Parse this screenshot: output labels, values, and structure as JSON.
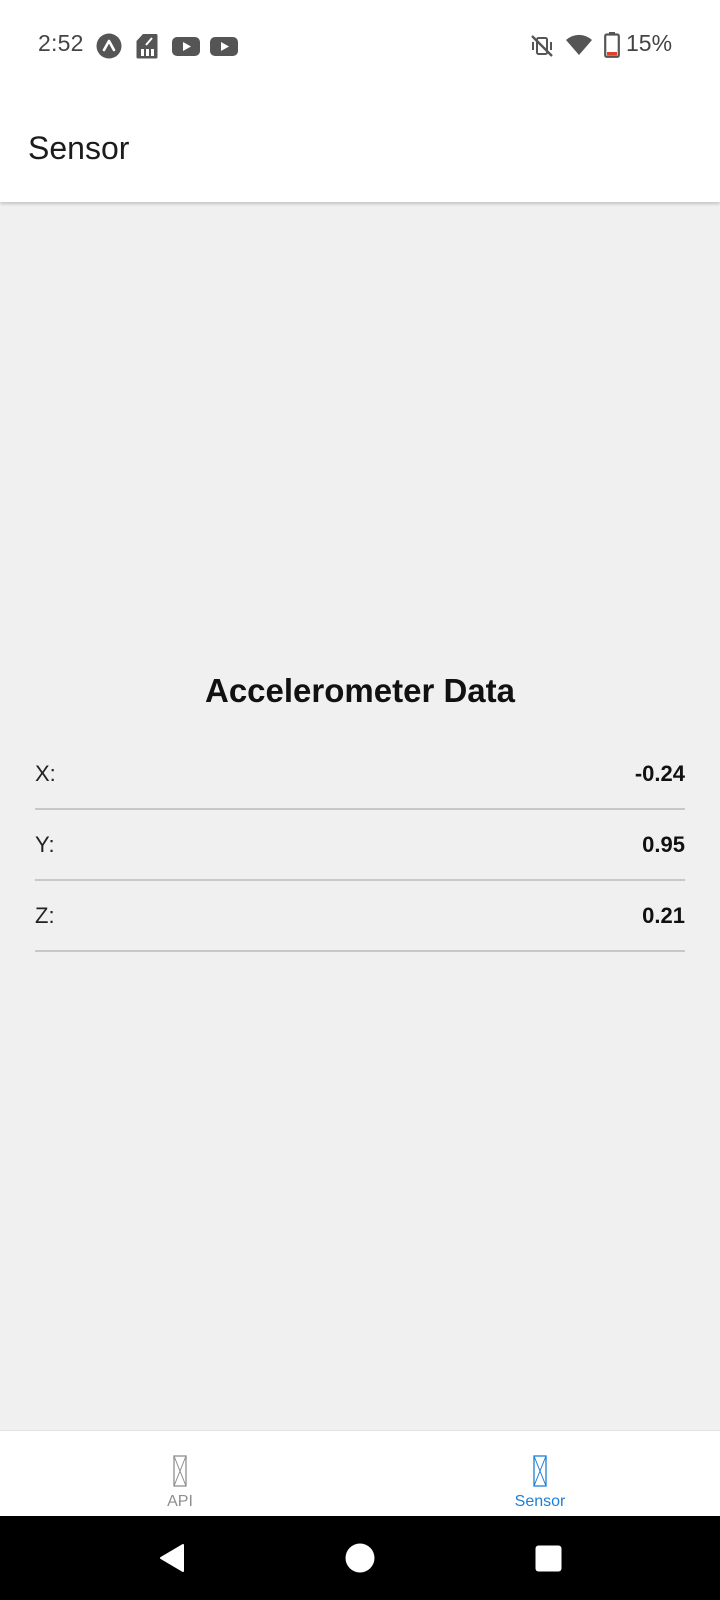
{
  "status_bar": {
    "time": "2:52",
    "battery": "15%",
    "icons": [
      "expo-icon",
      "sd-card-icon",
      "youtube-icon",
      "youtube-icon",
      "mute-vibrate-off-icon",
      "wifi-icon",
      "battery-low-icon"
    ]
  },
  "header": {
    "title": "Sensor"
  },
  "accelerometer": {
    "title": "Accelerometer Data",
    "rows": [
      {
        "label": "X:",
        "value": "-0.24"
      },
      {
        "label": "Y:",
        "value": "0.95"
      },
      {
        "label": "Z:",
        "value": "0.21"
      }
    ]
  },
  "tabs": [
    {
      "label": "API",
      "active": false,
      "icon": "missing-glyph-icon"
    },
    {
      "label": "Sensor",
      "active": true,
      "icon": "missing-glyph-icon"
    }
  ],
  "colors": {
    "active_tab": "#1e7fd6",
    "inactive_tab": "#8e8e8e",
    "battery_low": "#e0402a"
  },
  "nav": {
    "icons": [
      "back-icon",
      "home-icon",
      "recents-icon"
    ]
  }
}
